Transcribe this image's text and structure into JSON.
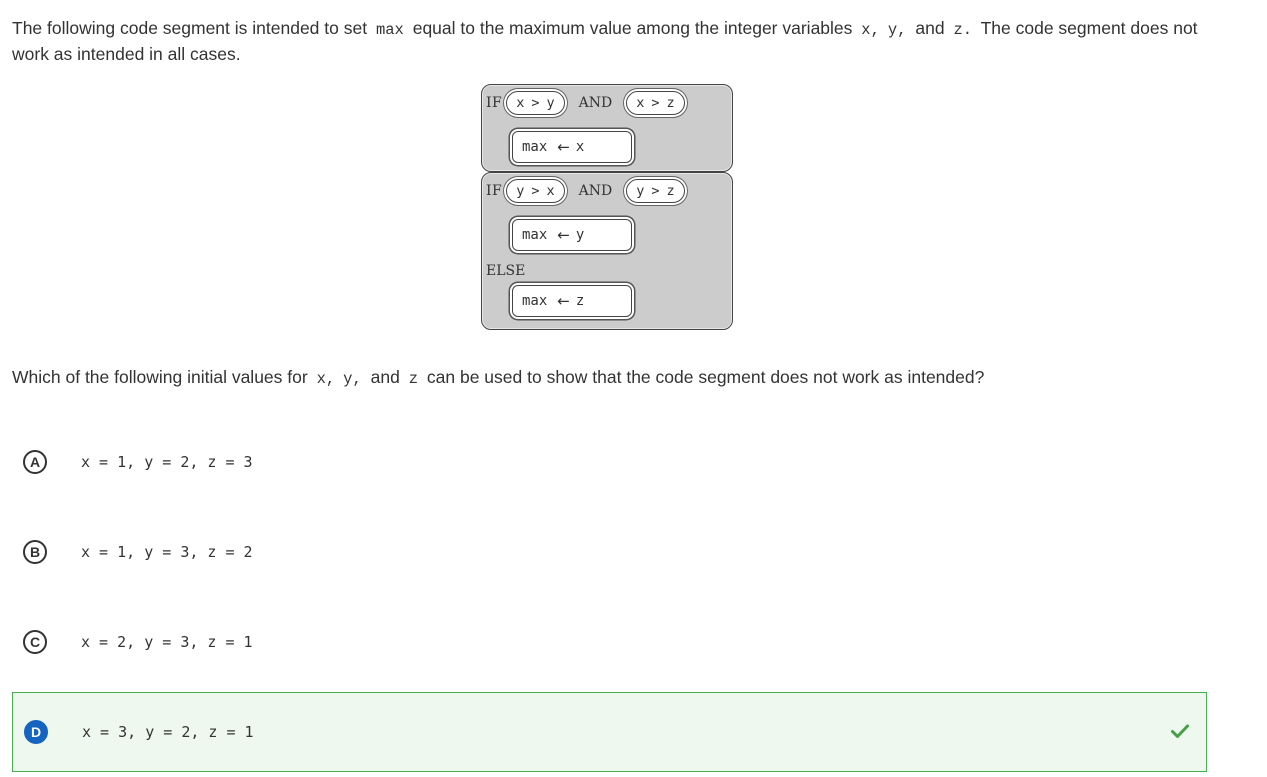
{
  "question": {
    "prompt_parts": [
      "The following code segment is intended to set ",
      "max",
      " equal to the maximum value among the integer variables ",
      "x,",
      "y,",
      " and ",
      "z.",
      " The code segment does not work as intended in all cases."
    ],
    "ask_parts": [
      "Which of the following initial values for ",
      "x,",
      "y,",
      " and ",
      "z",
      " can be used to show that the code segment does not work as intended?"
    ]
  },
  "diagram": {
    "block1": {
      "keyword": "IF",
      "cond1": [
        "x",
        ">",
        "y"
      ],
      "joiner": "AND",
      "cond2": [
        "x",
        ">",
        "z"
      ],
      "assign_var": "max",
      "assign_arrow": "←",
      "assign_value": "x"
    },
    "block2": {
      "keyword": "IF",
      "cond1": [
        "y",
        ">",
        "x"
      ],
      "joiner": "AND",
      "cond2": [
        "y",
        ">",
        "z"
      ],
      "assign_var": "max",
      "assign_arrow": "←",
      "assign_value": "y",
      "else_keyword": "ELSE",
      "else_assign_var": "max",
      "else_assign_arrow": "←",
      "else_assign_value": "z"
    }
  },
  "choices": [
    {
      "letter": "A",
      "text": "x = 1, y = 2, z = 3",
      "selected": false
    },
    {
      "letter": "B",
      "text": "x = 1, y = 3, z = 2",
      "selected": false
    },
    {
      "letter": "C",
      "text": "x = 2, y = 3, z = 1",
      "selected": false
    },
    {
      "letter": "D",
      "text": "x = 3, y = 2, z = 1",
      "selected": true,
      "status_icon": "check-icon"
    }
  ],
  "colors": {
    "selected_bg": "#eef8ee",
    "selected_border": "#4caf50",
    "selected_letter": "#1565c0",
    "check": "#43a047",
    "block_fill": "#cccccc"
  }
}
